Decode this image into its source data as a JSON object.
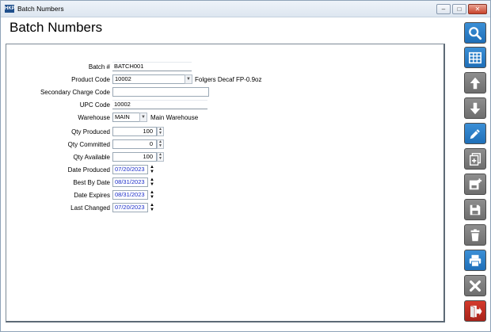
{
  "window": {
    "title": "Batch Numbers",
    "icon_text": "ΗΚP",
    "minimize": "–",
    "maximize": "□",
    "close": "✕"
  },
  "page_title": "Batch Numbers",
  "form": {
    "batch": {
      "label": "Batch #",
      "value": "BATCH001"
    },
    "product_code": {
      "label": "Product Code",
      "value": "10002",
      "description": "Folgers Decaf FP-0.9oz"
    },
    "secondary_charge_code": {
      "label": "Secondary Charge Code",
      "value": ""
    },
    "upc_code": {
      "label": "UPC Code",
      "value": "10002"
    },
    "warehouse": {
      "label": "Warehouse",
      "value": "MAIN",
      "description": "Main Warehouse"
    },
    "qty_produced": {
      "label": "Qty Produced",
      "value": "100"
    },
    "qty_committed": {
      "label": "Qty Committed",
      "value": "0"
    },
    "qty_available": {
      "label": "Qty Available",
      "value": "100"
    },
    "date_produced": {
      "label": "Date Produced",
      "value": "07/20/2023"
    },
    "best_by_date": {
      "label": "Best By Date",
      "value": "08/31/2023"
    },
    "date_expires": {
      "label": "Date Expires",
      "value": "08/31/2023"
    },
    "last_changed": {
      "label": "Last Changed",
      "value": "07/20/2023"
    }
  },
  "toolbar": {
    "buttons": [
      "search-icon",
      "grid-icon",
      "arrow-up-icon",
      "arrow-down-icon",
      "pencil-icon",
      "copy-icon",
      "save-new-icon",
      "save-icon",
      "trash-icon",
      "print-icon",
      "close-icon",
      "exit-icon"
    ],
    "colors": {
      "blue": "#2a7fc9",
      "gray": "#7d7d7d",
      "red": "#c0302a"
    }
  }
}
